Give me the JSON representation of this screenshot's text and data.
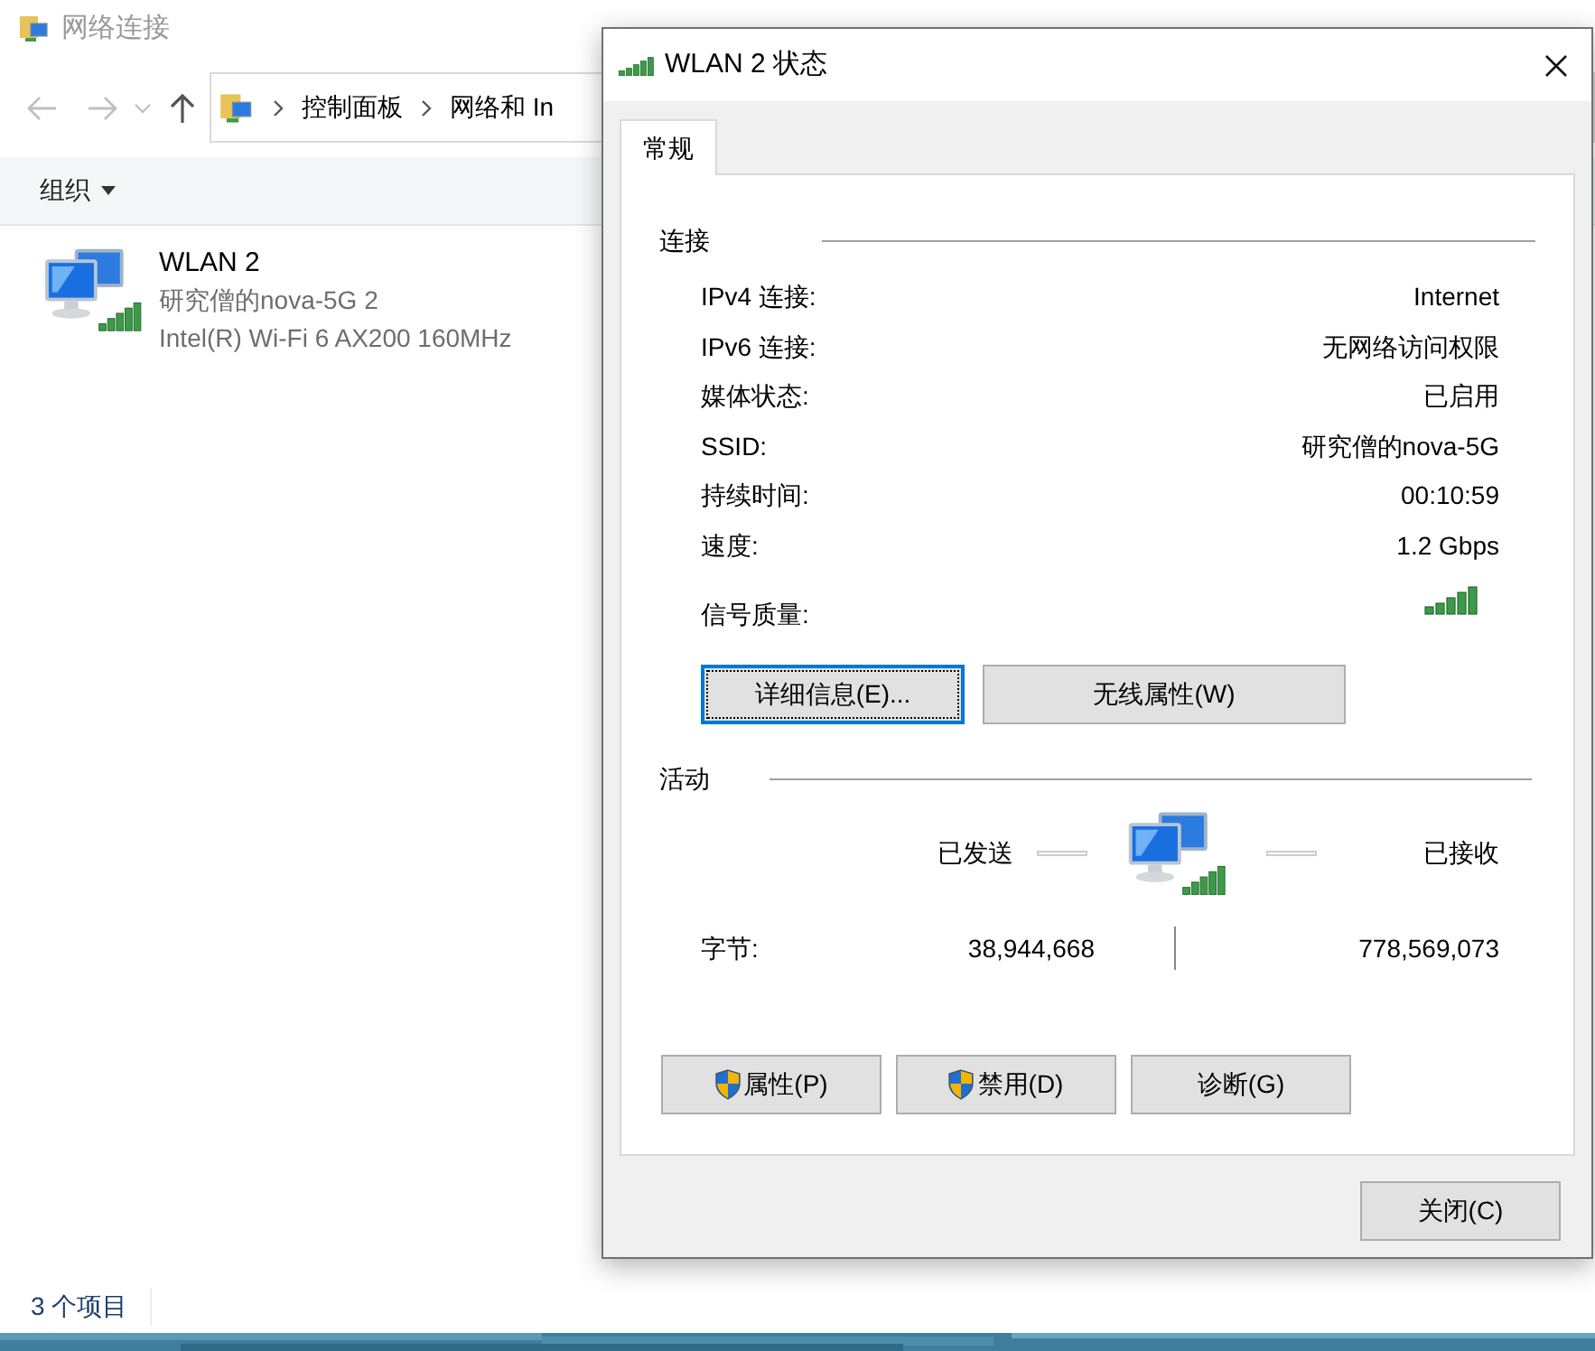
{
  "explorer": {
    "title": "网络连接",
    "breadcrumb": [
      "控制面板",
      "网络和 In"
    ],
    "organize": "组织",
    "items": [
      {
        "name": "WLAN 2",
        "network": "研究僧的nova-5G 2",
        "adapter": "Intel(R) Wi-Fi 6 AX200 160MHz"
      }
    ],
    "status": "3 个项目"
  },
  "dialog": {
    "title": "WLAN 2 状态",
    "tabs": [
      {
        "label": "常规",
        "selected": true
      }
    ],
    "connection": {
      "heading": "连接",
      "rows": [
        {
          "label": "IPv4 连接:",
          "value": "Internet"
        },
        {
          "label": "IPv6 连接:",
          "value": "无网络访问权限"
        },
        {
          "label": "媒体状态:",
          "value": "已启用"
        },
        {
          "label": "SSID:",
          "value": "研究僧的nova-5G"
        },
        {
          "label": "持续时间:",
          "value": "00:10:59"
        },
        {
          "label": "速度:",
          "value": "1.2 Gbps"
        }
      ],
      "signal_label": "信号质量:",
      "buttons": [
        {
          "label": "详细信息(E)...",
          "focused": true
        },
        {
          "label": "无线属性(W)",
          "focused": false
        }
      ]
    },
    "activity": {
      "heading": "活动",
      "sent": "已发送",
      "received": "已接收",
      "bytes_label": "字节:",
      "bytes_sent": "38,944,668",
      "bytes_received": "778,569,073"
    },
    "buttons": [
      {
        "label": "属性(P)",
        "kind": "shield"
      },
      {
        "label": "禁用(D)",
        "kind": "shield"
      },
      {
        "label": "诊断(G)",
        "kind": "plain"
      }
    ],
    "close": "关闭(C)"
  }
}
